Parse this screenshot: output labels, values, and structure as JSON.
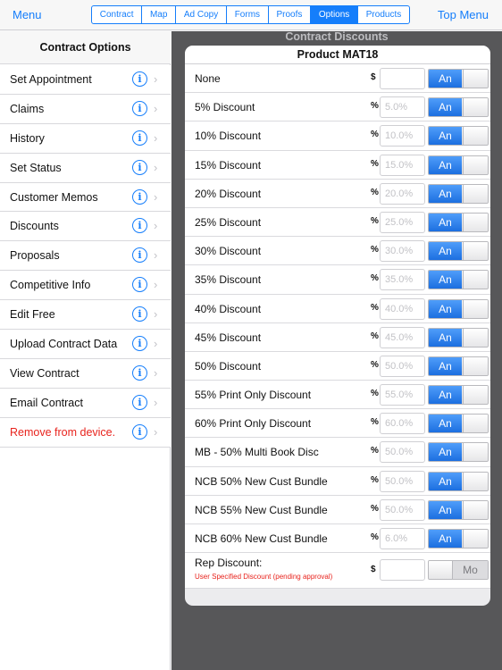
{
  "navbar": {
    "left_label": "Menu",
    "right_label": "Top Menu",
    "tabs": [
      {
        "label": "Contract",
        "active": false
      },
      {
        "label": "Map",
        "active": false
      },
      {
        "label": "Ad Copy",
        "active": false
      },
      {
        "label": "Forms",
        "active": false
      },
      {
        "label": "Proofs",
        "active": false
      },
      {
        "label": "Options",
        "active": true
      },
      {
        "label": "Products",
        "active": false
      }
    ]
  },
  "sidebar": {
    "title": "Contract Options",
    "items": [
      {
        "label": "Set Appointment"
      },
      {
        "label": "Claims"
      },
      {
        "label": "History"
      },
      {
        "label": "Set Status"
      },
      {
        "label": "Customer Memos"
      },
      {
        "label": "Discounts"
      },
      {
        "label": "Proposals"
      },
      {
        "label": "Competitive Info"
      },
      {
        "label": "Edit Free"
      },
      {
        "label": "Upload Contract Data"
      },
      {
        "label": "View Contract"
      },
      {
        "label": "Email Contract"
      },
      {
        "label": "Remove from device.",
        "danger": true
      }
    ]
  },
  "content": {
    "title": "Contract Discounts",
    "panel_title": "Product MAT18",
    "discounts": [
      {
        "name": "None",
        "unit": "$",
        "placeholder": "",
        "toggle": "An"
      },
      {
        "name": "5% Discount",
        "unit": "%",
        "placeholder": "5.0%",
        "toggle": "An"
      },
      {
        "name": "10% Discount",
        "unit": "%",
        "placeholder": "10.0%",
        "toggle": "An"
      },
      {
        "name": "15% Discount",
        "unit": "%",
        "placeholder": "15.0%",
        "toggle": "An"
      },
      {
        "name": "20% Discount",
        "unit": "%",
        "placeholder": "20.0%",
        "toggle": "An"
      },
      {
        "name": "25% Discount",
        "unit": "%",
        "placeholder": "25.0%",
        "toggle": "An"
      },
      {
        "name": "30% Discount",
        "unit": "%",
        "placeholder": "30.0%",
        "toggle": "An"
      },
      {
        "name": "35% Discount",
        "unit": "%",
        "placeholder": "35.0%",
        "toggle": "An"
      },
      {
        "name": "40% Discount",
        "unit": "%",
        "placeholder": "40.0%",
        "toggle": "An"
      },
      {
        "name": "45% Discount",
        "unit": "%",
        "placeholder": "45.0%",
        "toggle": "An"
      },
      {
        "name": "50% Discount",
        "unit": "%",
        "placeholder": "50.0%",
        "toggle": "An"
      },
      {
        "name": "55% Print Only Discount",
        "unit": "%",
        "placeholder": "55.0%",
        "toggle": "An"
      },
      {
        "name": "60% Print Only Discount",
        "unit": "%",
        "placeholder": "60.0%",
        "toggle": "An"
      },
      {
        "name": "MB - 50% Multi Book  Disc",
        "unit": "%",
        "placeholder": "50.0%",
        "toggle": "An"
      },
      {
        "name": "NCB 50% New Cust Bundle",
        "unit": "%",
        "placeholder": "50.0%",
        "toggle": "An"
      },
      {
        "name": "NCB 55% New Cust Bundle",
        "unit": "%",
        "placeholder": "50.0%",
        "toggle": "An"
      },
      {
        "name": "NCB 60% New Cust Bundle",
        "unit": "%",
        "placeholder": "6.0%",
        "toggle": "An"
      }
    ],
    "rep_discount": {
      "name": "Rep Discount:",
      "note": "User Specified Discount (pending approval)",
      "unit": "$",
      "placeholder": "",
      "toggle": "Mo"
    }
  },
  "colors": {
    "accent": "#157efb",
    "danger": "#e8231d",
    "content_background": "#575759",
    "toggle_on": "#1c6fe0"
  },
  "icons": {
    "info": "info-circle-icon",
    "chevron": "chevron-right-icon"
  }
}
